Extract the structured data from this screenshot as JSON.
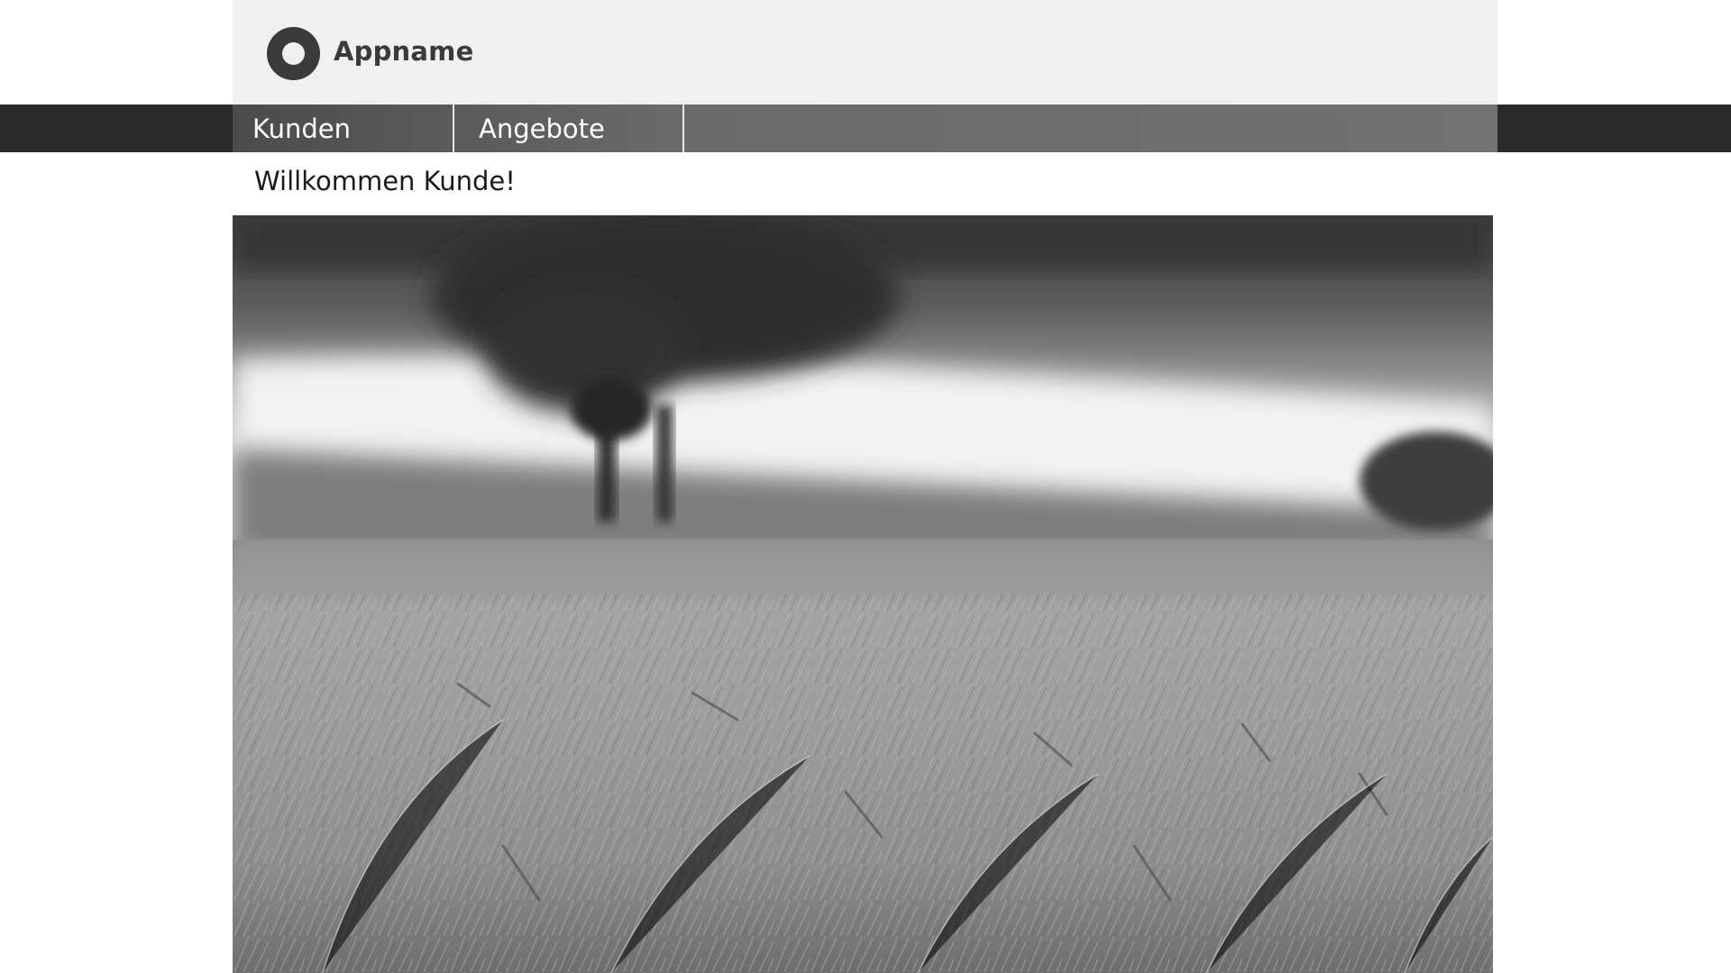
{
  "header": {
    "app_name": "Appname",
    "logo_icon": "circle-ring-icon"
  },
  "nav": {
    "tabs": [
      {
        "label": "Kunden"
      },
      {
        "label": "Angebote"
      }
    ]
  },
  "main": {
    "welcome_text": "Willkommen Kunde!",
    "hero_image": "wheat-field-tree-photo"
  },
  "colors": {
    "header_bg": "#f0f0f0",
    "nav_bg": "#2a2a2a",
    "accent": "#3a3a3a"
  }
}
